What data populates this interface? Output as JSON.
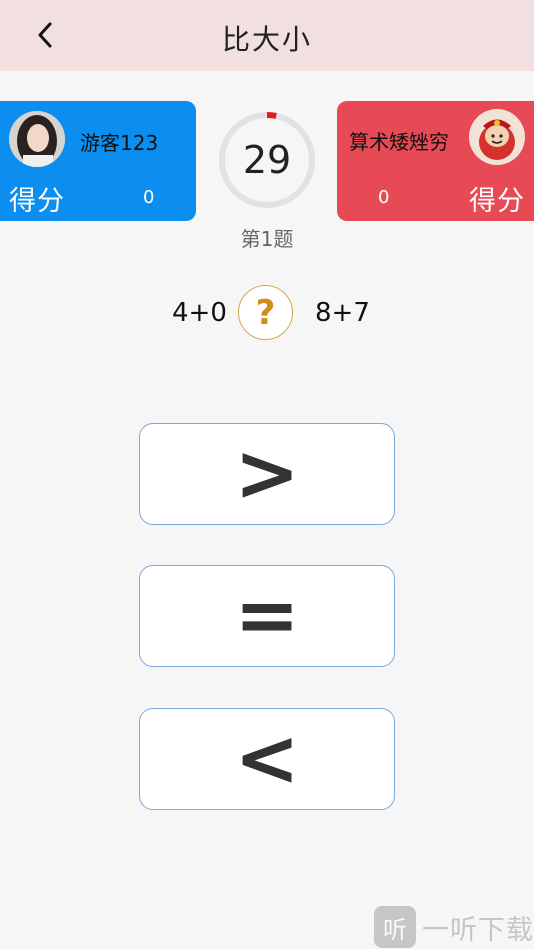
{
  "header": {
    "title": "比大小",
    "back_icon": "chevron-left-icon"
  },
  "player_left": {
    "name": "游客123",
    "score_label": "得分",
    "score": "0",
    "color": "#0b8ef0"
  },
  "player_right": {
    "name": "算术矮矬穷",
    "score_label": "得分",
    "score": "0",
    "color": "#e84a55"
  },
  "timer": {
    "value": "29",
    "progress_fraction": 0.033,
    "accent": "#e01c1c"
  },
  "question": {
    "label": "第1题",
    "left_expr": "4+0",
    "right_expr": "8+7",
    "unknown_symbol": "?"
  },
  "answers": {
    "greater": ">",
    "equal": "=",
    "less": "<"
  },
  "watermark": {
    "logo_text": "听",
    "text": "一听下载"
  }
}
